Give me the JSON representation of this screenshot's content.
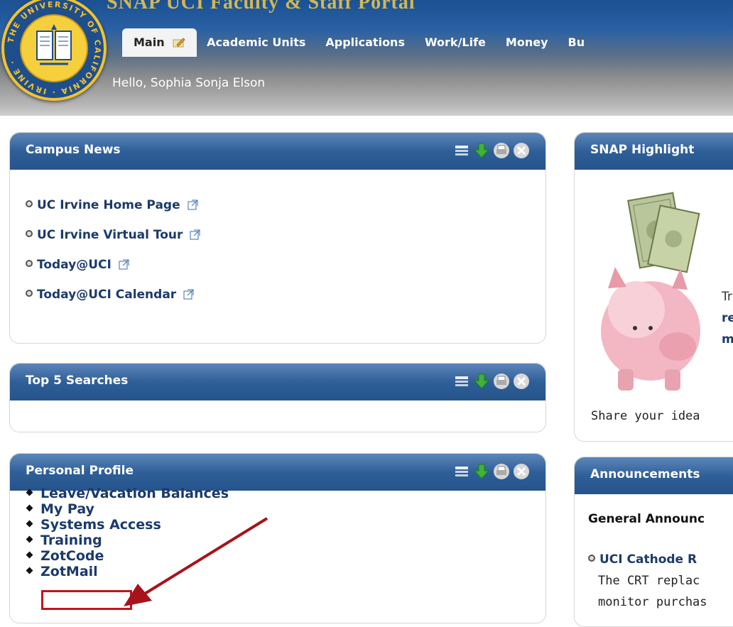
{
  "header": {
    "title_partial": "SNAP  UCI Faculty & Staff Portal",
    "greeting": "Hello, Sophia Sonja Elson",
    "seal_text": [
      "THE UNIVERSITY OF",
      "CALIFORNIA",
      "IRVINE"
    ],
    "tabs": [
      {
        "label": "Main",
        "active": true
      },
      {
        "label": "Academic Units"
      },
      {
        "label": "Applications"
      },
      {
        "label": "Work/Life"
      },
      {
        "label": "Money"
      },
      {
        "label": "Bu"
      }
    ]
  },
  "campus_news": {
    "title": "Campus News",
    "links": [
      "UC Irvine Home Page",
      "UC Irvine Virtual Tour",
      "Today@UCI",
      "Today@UCI Calendar"
    ]
  },
  "top_searches": {
    "title": "Top 5 Searches"
  },
  "personal_profile": {
    "title": "Personal Profile",
    "items": [
      "Leave/Vacation Balances",
      "My Pay",
      "Systems Access",
      "Training",
      "ZotCode",
      "ZotMail"
    ]
  },
  "snap_highlight": {
    "title": "SNAP Highlight",
    "side_text": [
      "Tr",
      "re",
      "m"
    ],
    "share_text": "Share your idea"
  },
  "announcements": {
    "title": "Announcements",
    "section": "General Announc",
    "item_link": "UCI Cathode R",
    "item_text_1": "The CRT replac",
    "item_text_2": "monitor purchas"
  },
  "colors": {
    "header_blue": "#1b5192",
    "portlet_blue": "#2f5f98",
    "link_navy": "#1b3a6b",
    "annotation_red": "#c0161c",
    "seal_gold": "#f2c230"
  }
}
